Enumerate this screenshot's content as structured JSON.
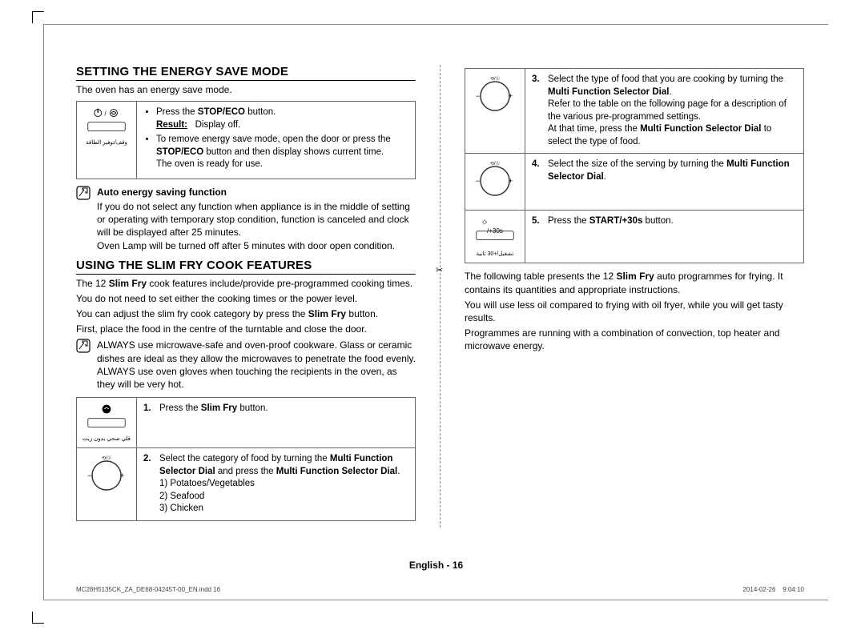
{
  "heading1": "SETTING THE ENERGY SAVE MODE",
  "intro1": "The oven has an energy save mode.",
  "ecoIconLabel": "وقف/توفير الطاقة",
  "ecoBullets": {
    "b1a": "Press the ",
    "b1b": "STOP/ECO",
    "b1c": " button.",
    "r1": "Result:",
    "r1v": "Display off.",
    "b2a": "To remove energy save mode, open the door or press the ",
    "b2b": "STOP/ECO",
    "b2c": " button and then display shows current time.",
    "b2d": "The oven is ready for use."
  },
  "noteTitle": "Auto energy saving function",
  "noteBody1": "If you do not select any function when appliance is in the middle of setting or operating with temporary stop condition, function is canceled and clock will be displayed after 25 minutes.",
  "noteBody2": "Oven Lamp will be turned off after 5 minutes with door open condition.",
  "heading2": "USING THE SLIM FRY COOK FEATURES",
  "slim_p1a": "The 12 ",
  "slim_p1b": "Slim Fry",
  "slim_p1c": " cook features include/provide pre-programmed cooking times.",
  "slim_p2": "You do not need to set either the cooking times or the power level.",
  "slim_p3a": "You can adjust the slim fry cook category by press the ",
  "slim_p3b": "Slim Fry",
  "slim_p3c": " button.",
  "slim_p4": "First, place the food in the centre of the turntable and close the door.",
  "warnBody": "ALWAYS use microwave-safe and oven-proof cookware. Glass or ceramic dishes are ideal as they allow the microwaves to penetrate the food evenly. ALWAYS use oven gloves when touching the recipients in the oven, as they will be very hot.",
  "slimBtnLabel": "قلي صحي بدون زيت",
  "step1n": "1.",
  "step1a": "Press the ",
  "step1b": "Slim Fry",
  "step1c": " button.",
  "step2n": "2.",
  "step2a": "Select the category of food by turning the ",
  "step2b": "Multi Function Selector Dial",
  "step2c": " and press the ",
  "step2d": "Multi Function Selector Dial",
  "step2e": ".",
  "step2opt1": "1) Potatoes/Vegetables",
  "step2opt2": "2) Seafood",
  "step2opt3": "3) Chicken",
  "step3n": "3.",
  "step3a": "Select the type of food that you are cooking by turning the ",
  "step3b": "Multi Function Selector Dial",
  "step3c": ".",
  "step3d": "Refer to the table on the following page for a description of the various pre-programmed settings.",
  "step3e1": "At that time, press the ",
  "step3e2": "Multi Function Selector Dial",
  "step3e3": " to select the type of food.",
  "step4n": "4.",
  "step4a": "Select the size of the serving by turning the ",
  "step4b": "Multi Function Selector Dial",
  "step4c": ".",
  "step5n": "5.",
  "step5a": "Press the ",
  "step5b": "START/+30s",
  "step5c": " button.",
  "startIconTop": "/+30s",
  "startIconLabel": "تشغيل/+30 ثانية",
  "right_p1a": "The following table presents the 12 ",
  "right_p1b": "Slim Fry",
  "right_p1c": " auto programmes for frying. It contains its quantities and appropriate instructions.",
  "right_p2": "You will use less oil compared to frying with oil fryer, while you will get tasty results.",
  "right_p3": "Programmes are running with a combination of convection, top heater and microwave energy.",
  "footer": "English - 16",
  "imprintLeft": "MC28H5135CK_ZA_DE68-04245T-00_EN.indd   16",
  "imprintRight": "2014-02-26     9:04:10"
}
